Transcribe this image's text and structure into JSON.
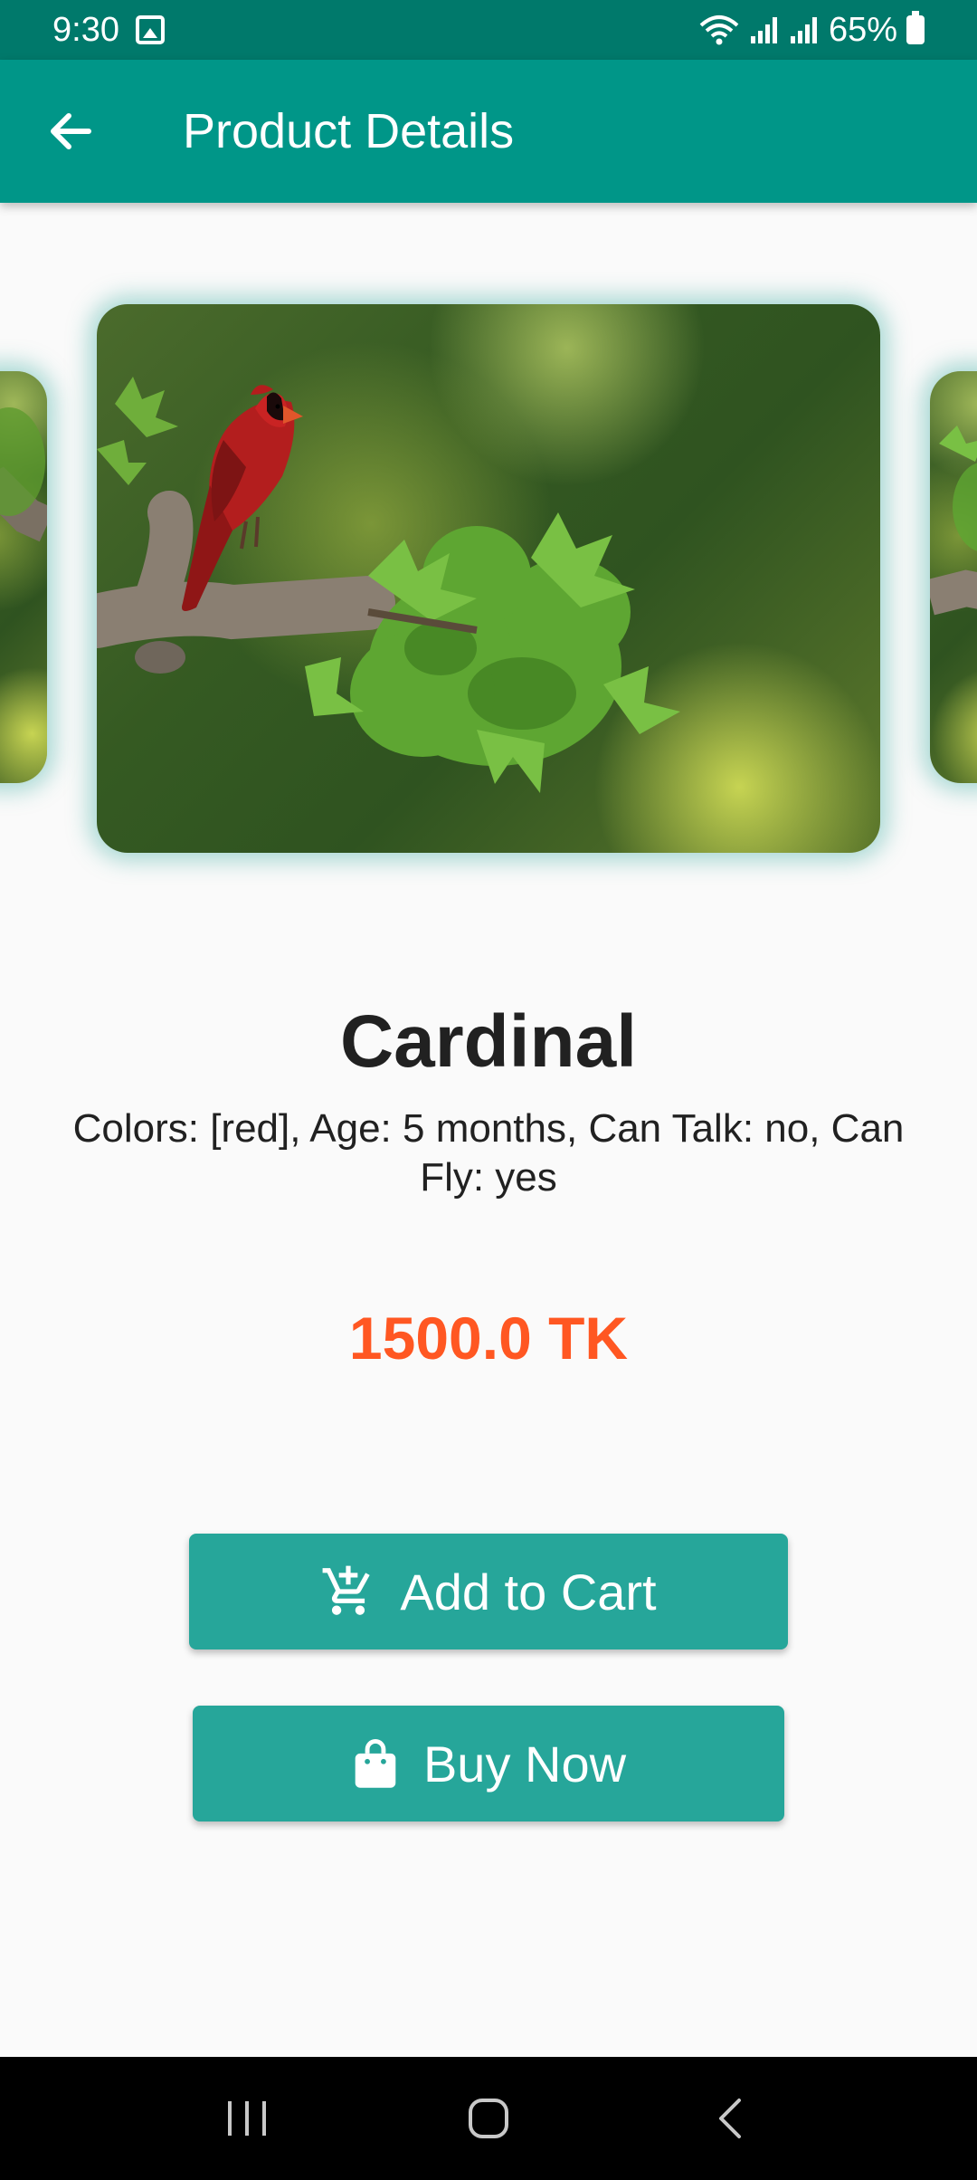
{
  "status_bar": {
    "time": "9:30",
    "battery": "65%",
    "icons": [
      "gallery-icon",
      "wifi-icon",
      "signal-icon",
      "signal-icon",
      "battery-icon"
    ]
  },
  "app_bar": {
    "title": "Product Details",
    "back_icon": "arrow-back-icon"
  },
  "carousel": {
    "images": [
      "cardinal-bird-photo",
      "cardinal-bird-photo",
      "cardinal-bird-photo"
    ],
    "active_index": 1
  },
  "product": {
    "name": "Cardinal",
    "description": "Colors: [red], Age: 5 months, Can Talk: no, Can Fly: yes",
    "price": "1500.0 TK"
  },
  "actions": {
    "add_to_cart": {
      "label": "Add to Cart",
      "icon": "add-shopping-cart-icon"
    },
    "buy_now": {
      "label": "Buy Now",
      "icon": "shopping-bag-icon"
    }
  },
  "nav_bar": {
    "buttons": [
      "recents-icon",
      "home-icon",
      "back-icon"
    ]
  },
  "colors": {
    "status_bar": "#00796b",
    "app_bar": "#009688",
    "button": "#26a69a",
    "price": "#ff5722",
    "background": "#fafafa"
  }
}
